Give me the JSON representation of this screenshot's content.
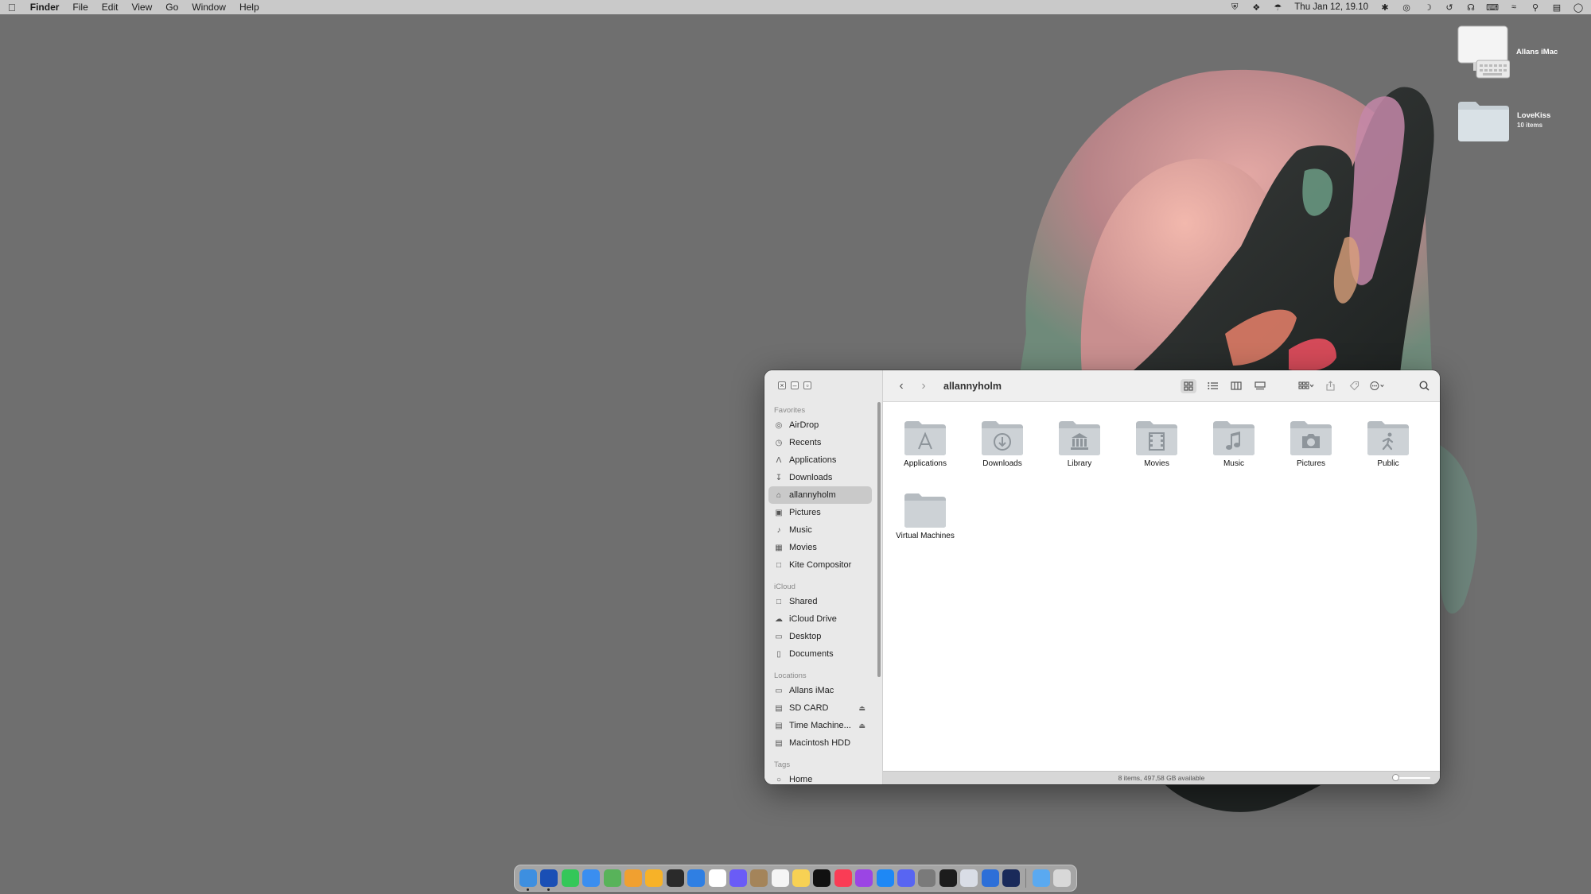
{
  "menubar": {
    "app_name": "Finder",
    "items": [
      "File",
      "Edit",
      "View",
      "Go",
      "Window",
      "Help"
    ],
    "clock": "Thu Jan 12, 19.10"
  },
  "desktop": {
    "icons": [
      {
        "label": "Allans iMac",
        "sub": ""
      },
      {
        "label": "LoveKiss",
        "sub": "10 items"
      }
    ]
  },
  "finder": {
    "title": "allannyholm",
    "sidebar": {
      "favorites_header": "Favorites",
      "favorites": [
        {
          "label": "AirDrop",
          "icon": "airdrop-icon"
        },
        {
          "label": "Recents",
          "icon": "clock-icon"
        },
        {
          "label": "Applications",
          "icon": "applications-icon"
        },
        {
          "label": "Downloads",
          "icon": "download-icon"
        },
        {
          "label": "allannyholm",
          "icon": "home-icon",
          "selected": true
        },
        {
          "label": "Pictures",
          "icon": "photo-icon"
        },
        {
          "label": "Music",
          "icon": "music-note-icon"
        },
        {
          "label": "Movies",
          "icon": "film-icon"
        },
        {
          "label": "Kite Compositor",
          "icon": "folder-icon"
        }
      ],
      "icloud_header": "iCloud",
      "icloud": [
        {
          "label": "Shared",
          "icon": "shared-folder-icon"
        },
        {
          "label": "iCloud Drive",
          "icon": "cloud-icon"
        },
        {
          "label": "Desktop",
          "icon": "desktop-icon"
        },
        {
          "label": "Documents",
          "icon": "document-icon"
        }
      ],
      "locations_header": "Locations",
      "locations": [
        {
          "label": "Allans iMac",
          "icon": "computer-icon",
          "eject": false
        },
        {
          "label": "SD CARD",
          "icon": "drive-icon",
          "eject": true
        },
        {
          "label": "Time Machine...",
          "icon": "drive-icon",
          "eject": true
        },
        {
          "label": "Macintosh HDD",
          "icon": "drive-icon",
          "eject": false
        }
      ],
      "tags_header": "Tags",
      "tags": [
        {
          "label": "Home",
          "icon": "tag-circle-icon"
        }
      ]
    },
    "files": [
      {
        "name": "Applications",
        "glyph": "applications-glyph-icon"
      },
      {
        "name": "Downloads",
        "glyph": "download-glyph-icon"
      },
      {
        "name": "Library",
        "glyph": "library-glyph-icon"
      },
      {
        "name": "Movies",
        "glyph": "film-glyph-icon"
      },
      {
        "name": "Music",
        "glyph": "music-glyph-icon"
      },
      {
        "name": "Pictures",
        "glyph": "camera-glyph-icon"
      },
      {
        "name": "Public",
        "glyph": "public-glyph-icon"
      },
      {
        "name": "Virtual Machines",
        "glyph": ""
      }
    ],
    "status": "8 items, 497,58 GB available"
  },
  "dock": {
    "apps": [
      {
        "icon": "finder-icon",
        "color": "#3d8fe0",
        "running": true
      },
      {
        "icon": "safari-icon",
        "color": "#1a4fb5",
        "running": true
      },
      {
        "icon": "messages-icon",
        "color": "#34c759",
        "running": false
      },
      {
        "icon": "mail-icon",
        "color": "#3a8ef0",
        "running": false
      },
      {
        "icon": "maps-icon",
        "color": "#58b35a",
        "running": false
      },
      {
        "icon": "photos-icon",
        "color": "#f0a030",
        "running": false
      },
      {
        "icon": "sketch-icon",
        "color": "#f7b228",
        "running": false
      },
      {
        "icon": "figma-icon",
        "color": "#2a2a2a",
        "running": false
      },
      {
        "icon": "xcode-icon",
        "color": "#2f7fe3",
        "running": false
      },
      {
        "icon": "calendar-icon",
        "color": "#ffffff",
        "running": false
      },
      {
        "icon": "messenger-icon",
        "color": "#6a5cf6",
        "running": false
      },
      {
        "icon": "contacts-icon",
        "color": "#a4845a",
        "running": false
      },
      {
        "icon": "reminders-icon",
        "color": "#f5f5f5",
        "running": false
      },
      {
        "icon": "notes-icon",
        "color": "#f7d154",
        "running": false
      },
      {
        "icon": "tv-icon",
        "color": "#111111",
        "running": false
      },
      {
        "icon": "music-icon",
        "color": "#fa3c55",
        "running": false
      },
      {
        "icon": "podcasts-icon",
        "color": "#9b45e4",
        "running": false
      },
      {
        "icon": "appstore-icon",
        "color": "#1e88f5",
        "running": false
      },
      {
        "icon": "discord-icon",
        "color": "#5865f2",
        "running": false
      },
      {
        "icon": "settings-icon",
        "color": "#7a7a7a",
        "running": false
      },
      {
        "icon": "terminal-icon",
        "color": "#1c1c1c",
        "running": false
      },
      {
        "icon": "preview-icon",
        "color": "#d9dde6",
        "running": false
      },
      {
        "icon": "pencil-app-icon",
        "color": "#2d6fd8",
        "running": false
      },
      {
        "icon": "video-app-icon",
        "color": "#1a2a5a",
        "running": false
      }
    ],
    "trailing": [
      {
        "icon": "downloads-stack-icon",
        "color": "#5aa9f0"
      },
      {
        "icon": "trash-icon",
        "color": "#d8d8d8"
      }
    ]
  }
}
